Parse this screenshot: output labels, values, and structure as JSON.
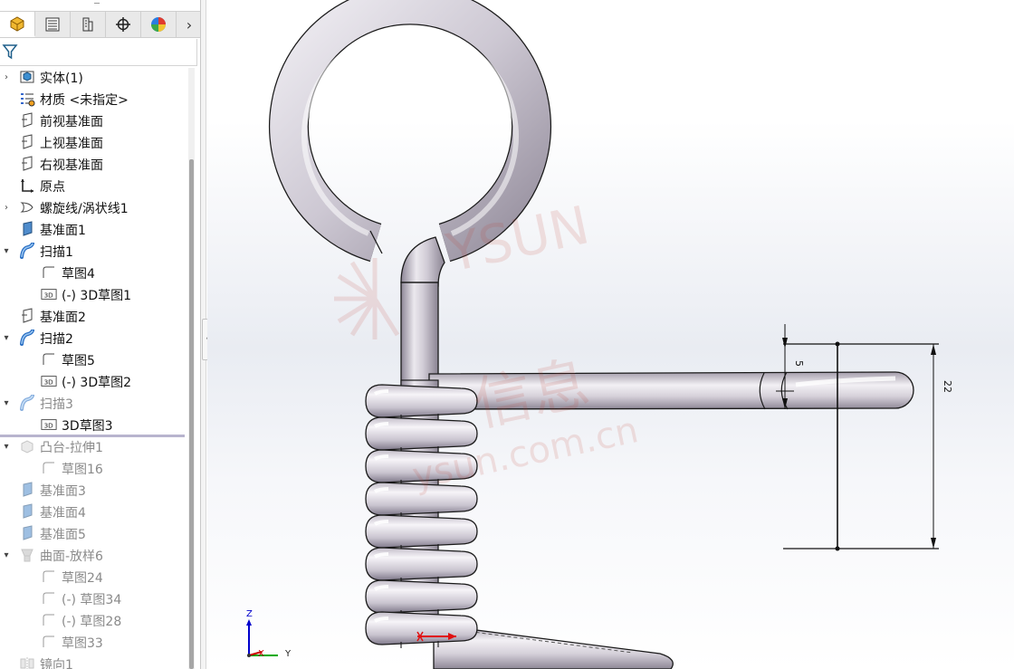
{
  "feature_manager": {
    "tabs": [
      {
        "name": "feature-manager-tab",
        "icon": "part-icon",
        "active": true
      },
      {
        "name": "property-manager-tab",
        "icon": "property-list-icon",
        "active": false
      },
      {
        "name": "configuration-manager-tab",
        "icon": "configuration-icon",
        "active": false
      },
      {
        "name": "dimxpert-manager-tab",
        "icon": "crosshair-icon",
        "active": false
      },
      {
        "name": "display-manager-tab",
        "icon": "appearance-pie-icon",
        "active": false
      }
    ],
    "more_tabs_glyph": "›",
    "tree": [
      {
        "label": "实体(1)",
        "icon": "solid-bodies-icon",
        "level": 0,
        "expand": "collapsed",
        "dim": false
      },
      {
        "label": "材质 <未指定>",
        "icon": "material-icon",
        "level": 0,
        "expand": "none",
        "dim": false
      },
      {
        "label": "前视基准面",
        "icon": "plane-icon",
        "level": 0,
        "expand": "none",
        "dim": false
      },
      {
        "label": "上视基准面",
        "icon": "plane-icon",
        "level": 0,
        "expand": "none",
        "dim": false
      },
      {
        "label": "右视基准面",
        "icon": "plane-icon",
        "level": 0,
        "expand": "none",
        "dim": false
      },
      {
        "label": "原点",
        "icon": "origin-icon",
        "level": 0,
        "expand": "none",
        "dim": false
      },
      {
        "label": "螺旋线/涡状线1",
        "icon": "helix-icon",
        "level": 0,
        "expand": "collapsed",
        "dim": false
      },
      {
        "label": "基准面1",
        "icon": "ref-plane-icon",
        "level": 0,
        "expand": "none",
        "dim": false
      },
      {
        "label": "扫描1",
        "icon": "sweep-icon",
        "level": 0,
        "expand": "expanded",
        "dim": false
      },
      {
        "label": "草图4",
        "icon": "sketch-icon",
        "level": 1,
        "expand": "none",
        "dim": false
      },
      {
        "label": "(-) 3D草图1",
        "icon": "sketch3d-icon",
        "level": 1,
        "expand": "none",
        "dim": false
      },
      {
        "label": "基准面2",
        "icon": "plane-icon",
        "level": 0,
        "expand": "none",
        "dim": false
      },
      {
        "label": "扫描2",
        "icon": "sweep-icon",
        "level": 0,
        "expand": "expanded",
        "dim": false
      },
      {
        "label": "草图5",
        "icon": "sketch-icon",
        "level": 1,
        "expand": "none",
        "dim": false
      },
      {
        "label": "(-) 3D草图2",
        "icon": "sketch3d-icon",
        "level": 1,
        "expand": "none",
        "dim": false
      },
      {
        "label": "扫描3",
        "icon": "sweep-icon",
        "level": 0,
        "expand": "expanded",
        "dim": true
      },
      {
        "label": "3D草图3",
        "icon": "sketch3d-icon",
        "level": 1,
        "expand": "none",
        "dim": false
      },
      {
        "label": "凸台-拉伸1",
        "icon": "extrude-icon",
        "level": 0,
        "expand": "expanded",
        "dim": true
      },
      {
        "label": "草图16",
        "icon": "sketch-icon",
        "level": 1,
        "expand": "none",
        "dim": true
      },
      {
        "label": "基准面3",
        "icon": "ref-plane-icon",
        "level": 0,
        "expand": "none",
        "dim": true
      },
      {
        "label": "基准面4",
        "icon": "ref-plane-icon",
        "level": 0,
        "expand": "none",
        "dim": true
      },
      {
        "label": "基准面5",
        "icon": "ref-plane-icon",
        "level": 0,
        "expand": "none",
        "dim": true
      },
      {
        "label": "曲面-放样6",
        "icon": "loft-surface-icon",
        "level": 0,
        "expand": "expanded",
        "dim": true
      },
      {
        "label": "草图24",
        "icon": "sketch-icon",
        "level": 1,
        "expand": "none",
        "dim": true
      },
      {
        "label": "(-) 草图34",
        "icon": "sketch-icon",
        "level": 1,
        "expand": "none",
        "dim": true
      },
      {
        "label": "(-) 草图28",
        "icon": "sketch-icon",
        "level": 1,
        "expand": "none",
        "dim": true
      },
      {
        "label": "草图33",
        "icon": "sketch-icon",
        "level": 1,
        "expand": "none",
        "dim": true
      },
      {
        "label": "镜向1",
        "icon": "mirror-icon",
        "level": 0,
        "expand": "none",
        "dim": true
      }
    ]
  },
  "graphics": {
    "dimension_small": "5",
    "dimension_large": "22",
    "triad": {
      "z": "Z",
      "x": "X",
      "y": "Y"
    },
    "watermark": {
      "brand": "YSUN",
      "url": "ysun.com.cn",
      "cn": "信息"
    },
    "colors": {
      "spring": "#c8c3cc",
      "spring_edge": "#1a1a1a",
      "triad_z": "#0000cc",
      "triad_x": "#cc0000",
      "triad_y": "#00aa00"
    }
  }
}
